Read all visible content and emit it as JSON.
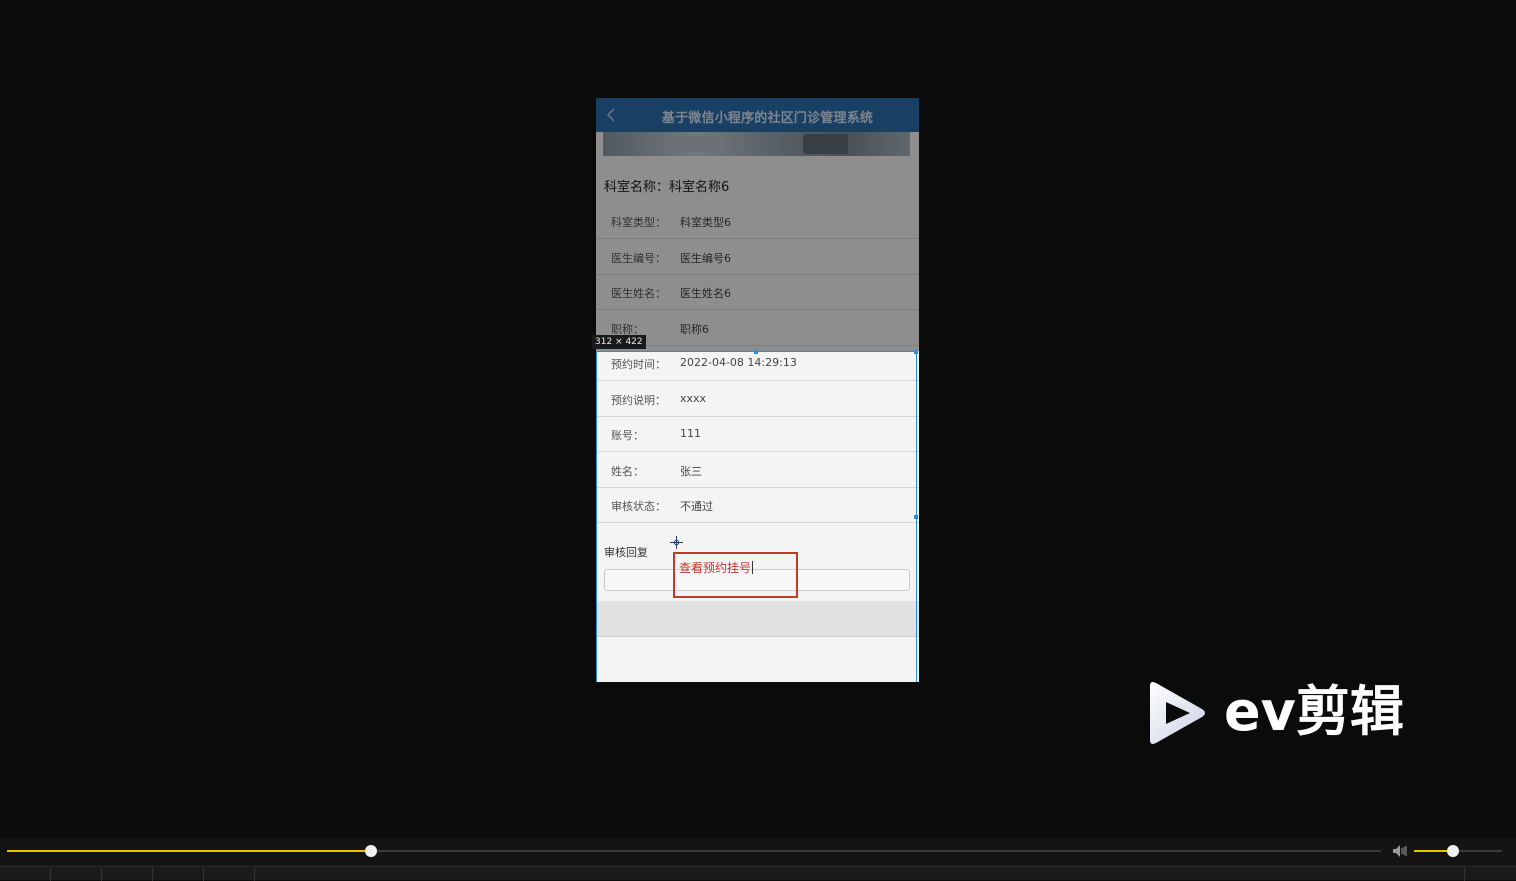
{
  "app": {
    "title": "基于微信小程序的社区门诊管理系统"
  },
  "department": {
    "title_label": "科室名称：",
    "title_value": "科室名称6",
    "fields": [
      {
        "label": "科室类型：",
        "value": "科室类型6"
      },
      {
        "label": "医生编号：",
        "value": "医生编号6"
      },
      {
        "label": "医生姓名：",
        "value": "医生姓名6"
      },
      {
        "label": "职称：",
        "value": "职称6"
      },
      {
        "label": "预约时间：",
        "value": "2022-04-08 14:29:13"
      },
      {
        "label": "预约说明：",
        "value": "xxxx"
      },
      {
        "label": "账号：",
        "value": "111"
      },
      {
        "label": "姓名：",
        "value": "张三"
      },
      {
        "label": "审核状态：",
        "value": "不通过"
      }
    ]
  },
  "reply": {
    "label": "审核回复"
  },
  "selection": {
    "size_text": "312 × 422"
  },
  "annotation": {
    "text": "查看预约挂号"
  },
  "watermark": {
    "text": "ev剪辑",
    "logo_icon": "ev-play-logo-icon"
  },
  "player": {
    "progress_fraction": 0.265,
    "volume_fraction": 0.44,
    "accent_color": "#e6c200"
  }
}
